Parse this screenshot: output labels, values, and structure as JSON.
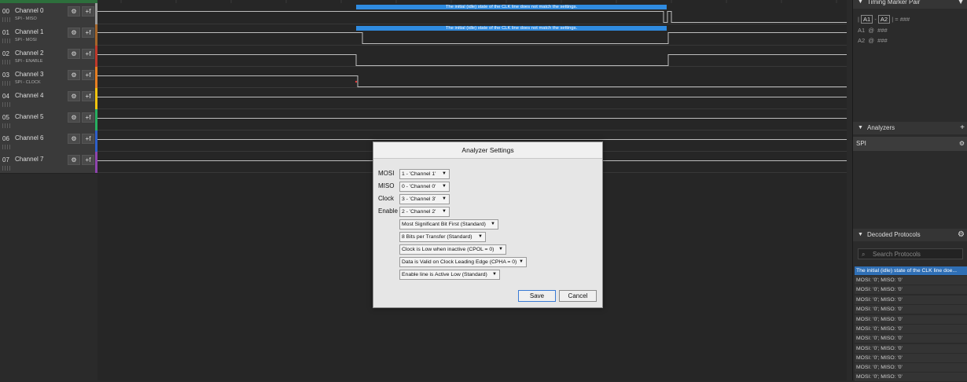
{
  "channels": [
    {
      "num": "00",
      "name": "Channel 0",
      "sub": "SPI - MISO",
      "color": "#9a9a9a"
    },
    {
      "num": "01",
      "name": "Channel 1",
      "sub": "SPI - MOSI",
      "color": "#a5662a"
    },
    {
      "num": "02",
      "name": "Channel 2",
      "sub": "SPI - ENABLE",
      "color": "#c0392b"
    },
    {
      "num": "03",
      "name": "Channel 3",
      "sub": "SPI - CLOCK",
      "color": "#e67e22"
    },
    {
      "num": "04",
      "name": "Channel 4",
      "sub": "",
      "color": "#f1c40f"
    },
    {
      "num": "05",
      "name": "Channel 5",
      "sub": "",
      "color": "#27ae60"
    },
    {
      "num": "06",
      "name": "Channel 6",
      "sub": "",
      "color": "#2e5fc9"
    },
    {
      "num": "07",
      "name": "Channel 7",
      "sub": "",
      "color": "#8e44ad"
    }
  ],
  "channel_buttons": {
    "settings": "⚙",
    "trigger": "+f"
  },
  "packet_message": "The initial (idle) state of the CLK line does not match the settings.",
  "right_panel": {
    "timing_header": "Timing Marker Pair",
    "timing_pair": {
      "a1": "A1",
      "dash": "-",
      "a2": "A2",
      "eq": "= ###"
    },
    "a1_row": {
      "label": "A1",
      "at": "@",
      "val": "###"
    },
    "a2_row": {
      "label": "A2",
      "at": "@",
      "val": "###"
    },
    "analyzers_header": "Analyzers",
    "analyzer_item": "SPI",
    "decoded_header": "Decoded Protocols",
    "search_placeholder": "Search Protocols",
    "decoded_rows": [
      "The initial (idle) state of the CLK line doe...",
      "MOSI: '0';  MISO: '0'",
      "MOSI: '0';  MISO: '0'",
      "MOSI: '0';  MISO: '0'",
      "MOSI: '0';  MISO: '0'",
      "MOSI: '0';  MISO: '0'",
      "MOSI: '0';  MISO: '0'",
      "MOSI: '0';  MISO: '0'",
      "MOSI: '0';  MISO: '0'",
      "MOSI: '0';  MISO: '0'",
      "MOSI: '0';  MISO: '0'",
      "MOSI: '0';  MISO: '0'"
    ]
  },
  "dialog": {
    "title": "Analyzer Settings",
    "mosi_label": "MOSI",
    "mosi_value": "1 - 'Channel 1'",
    "miso_label": "MISO",
    "miso_value": "0 - 'Channel 0'",
    "clock_label": "Clock",
    "clock_value": "3 - 'Channel 3'",
    "enable_label": "Enable",
    "enable_value": "2 - 'Channel 2'",
    "bit_order": "Most Significant Bit First (Standard)",
    "bits_per_transfer": "8 Bits per Transfer (Standard)",
    "cpol": "Clock is Low when inactive (CPOL = 0)",
    "cpha": "Data is Valid on Clock Leading Edge (CPHA = 0)",
    "enable_polarity": "Enable line is Active Low (Standard)",
    "save_label": "Save",
    "cancel_label": "Cancel"
  }
}
